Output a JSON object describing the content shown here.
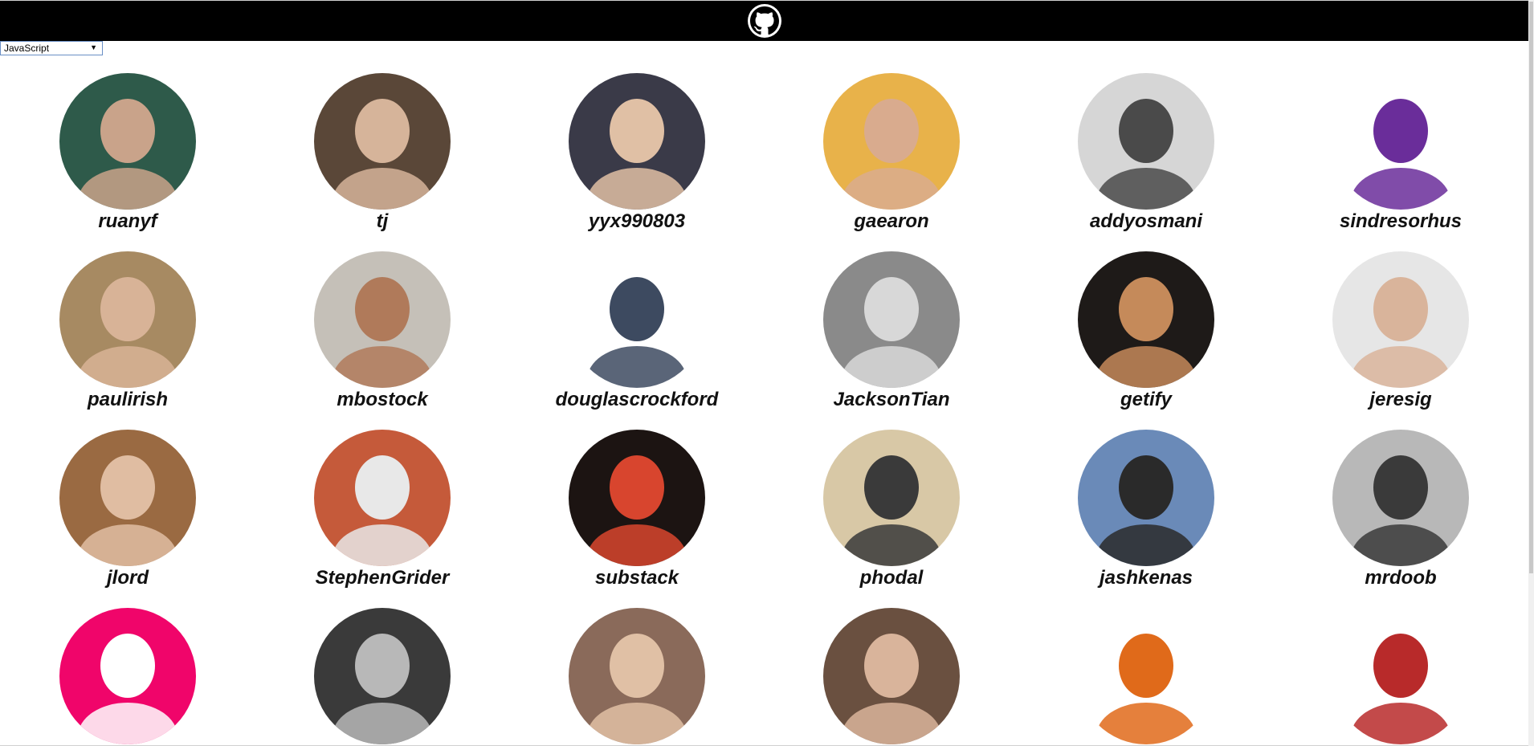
{
  "header": {
    "logo_icon": "github-octocat-icon"
  },
  "language_select": {
    "selected": "JavaScript"
  },
  "users": [
    {
      "name": "ruanyf",
      "bg": "#2e5a4a",
      "fg": "#c9a38a"
    },
    {
      "name": "tj",
      "bg": "#5a4738",
      "fg": "#d6b49a"
    },
    {
      "name": "yyx990803",
      "bg": "#3a3a48",
      "fg": "#e0c0a5"
    },
    {
      "name": "gaearon",
      "bg": "#e8b24a",
      "fg": "#d9ab8e"
    },
    {
      "name": "addyosmani",
      "bg": "#d6d6d6",
      "fg": "#4a4a4a"
    },
    {
      "name": "sindresorhus",
      "bg": "#ffffff",
      "fg": "#6a2d9a"
    },
    {
      "name": "paulirish",
      "bg": "#a78a62",
      "fg": "#d8b397"
    },
    {
      "name": "mbostock",
      "bg": "#c5c0b8",
      "fg": "#b07a5a"
    },
    {
      "name": "douglascrockford",
      "bg": "#ffffff",
      "fg": "#3d4a60"
    },
    {
      "name": "JacksonTian",
      "bg": "#8a8a8a",
      "fg": "#d8d8d8"
    },
    {
      "name": "getify",
      "bg": "#1e1a18",
      "fg": "#c58a5a"
    },
    {
      "name": "jeresig",
      "bg": "#e6e6e6",
      "fg": "#d9b49b"
    },
    {
      "name": "jlord",
      "bg": "#9a6a42",
      "fg": "#e0bda2"
    },
    {
      "name": "StephenGrider",
      "bg": "#c55a3a",
      "fg": "#e8e8e8"
    },
    {
      "name": "substack",
      "bg": "#1c1412",
      "fg": "#d8452e"
    },
    {
      "name": "phodal",
      "bg": "#d8c8a6",
      "fg": "#3a3a3a"
    },
    {
      "name": "jashkenas",
      "bg": "#6a8ab8",
      "fg": "#2a2a2a"
    },
    {
      "name": "mrdoob",
      "bg": "#b8b8b8",
      "fg": "#3a3a3a"
    },
    {
      "name": "",
      "bg": "#f0056a",
      "fg": "#ffffff"
    },
    {
      "name": "",
      "bg": "#3a3a3a",
      "fg": "#b8b8b8"
    },
    {
      "name": "",
      "bg": "#8a6a5a",
      "fg": "#e0c0a5"
    },
    {
      "name": "",
      "bg": "#6a5040",
      "fg": "#d9b49b"
    },
    {
      "name": "",
      "bg": "#ffffff",
      "fg": "#e06a1a"
    },
    {
      "name": "",
      "bg": "#ffffff",
      "fg": "#b82a2a"
    }
  ]
}
